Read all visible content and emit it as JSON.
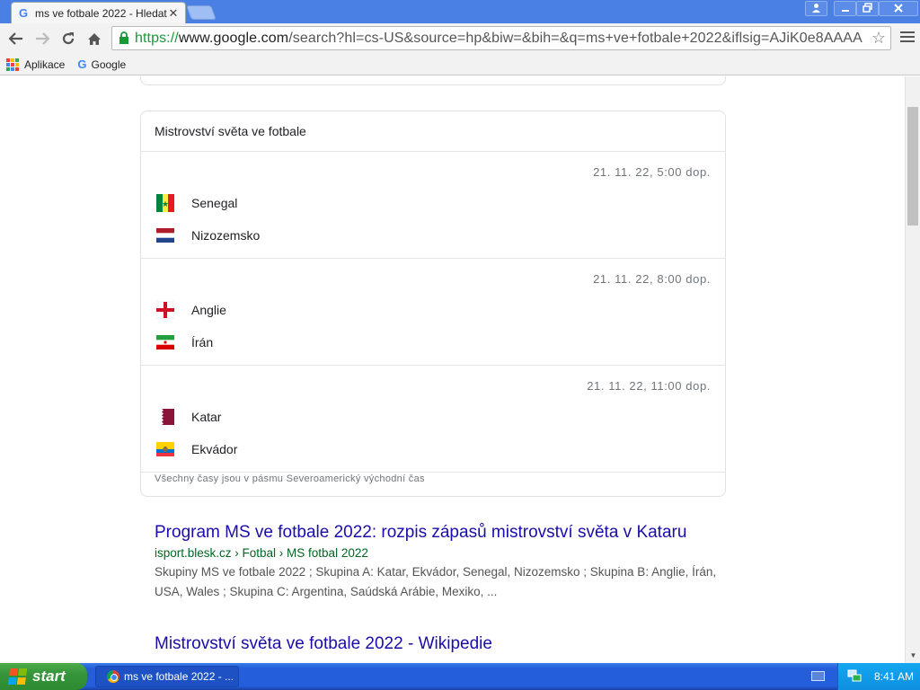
{
  "browser": {
    "tab_title": "ms ve fotbale 2022 - Hledat",
    "tab_close": "✕",
    "url_https": "https://",
    "url_host": "www.google.com",
    "url_rest": "/search?hl=cs-US&source=hp&biw=&bih=&q=ms+ve+fotbale+2022&iflsig=AJiK0e8AAAA",
    "bookmarks": [
      "Aplikace",
      "Google"
    ]
  },
  "sports_card": {
    "header": "Mistrovství světa ve fotbale",
    "matches": [
      {
        "time": "21. 11. 22, 5:00 dop.",
        "team1": "Senegal",
        "team2": "Nizozemsko"
      },
      {
        "time": "21. 11. 22, 8:00 dop.",
        "team1": "Anglie",
        "team2": "Írán"
      },
      {
        "time": "21. 11. 22, 11:00 dop.",
        "team1": "Katar",
        "team2": "Ekvádor"
      }
    ],
    "footnote": "Všechny časy jsou v pásmu Severoamerický východní čas"
  },
  "results": [
    {
      "title": "Program MS ve fotbale 2022: rozpis zápasů mistrovství světa v Kataru",
      "cite": "isport.blesk.cz › Fotbal › MS fotbal 2022",
      "snippet": "Skupiny MS ve fotbale 2022 ; Skupina A: Katar, Ekvádor, Senegal, Nizozemsko ; Skupina B: Anglie, Írán, USA, Wales ; Skupina C: Argentina, Saúdská Arábie, Mexiko, ..."
    },
    {
      "title": "Mistrovství světa ve fotbale 2022 - Wikipedie"
    }
  ],
  "taskbar": {
    "start_label": "start",
    "task_label": "ms ve fotbale 2022 - ...",
    "clock": "8:41 AM"
  },
  "colors": {
    "link": "#1a0dab",
    "cite": "#006621",
    "xp_blue": "#245edb",
    "start_green": "#35953a"
  }
}
